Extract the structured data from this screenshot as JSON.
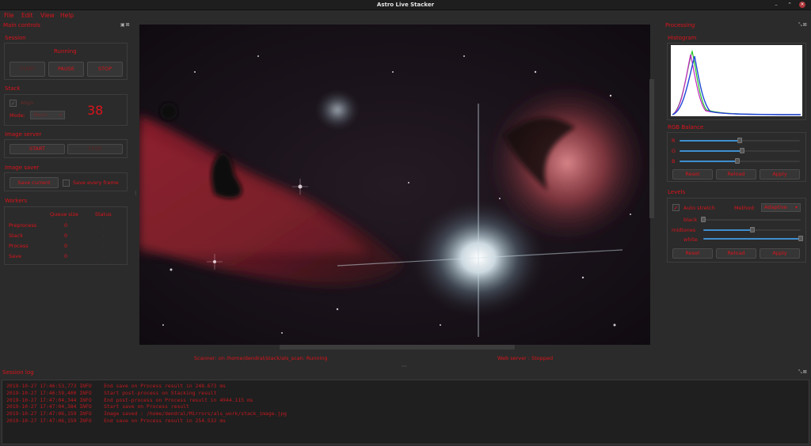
{
  "window": {
    "title": "Astro Live Stacker"
  },
  "menu": {
    "items": [
      "File",
      "Edit",
      "View",
      "Help"
    ]
  },
  "left_dock": {
    "title": "Main controls",
    "session": {
      "title": "Session",
      "status": "Running",
      "start_label": "START",
      "pause_label": "PAUSE",
      "stop_label": "STOP"
    },
    "stack": {
      "title": "Stack",
      "align_label": "Align",
      "align_checked": true,
      "mode_label": "Mode:",
      "mode_value": "Mean",
      "count": "38"
    },
    "image_server": {
      "title": "Image server",
      "start_label": "START",
      "stop_label": "STOP"
    },
    "image_saver": {
      "title": "Image saver",
      "save_current_label": "Save current",
      "save_every_label": "Save every frame",
      "save_every_checked": false
    },
    "workers": {
      "title": "Workers",
      "col_queue": "Queue size",
      "col_status": "Status",
      "rows": [
        {
          "name": "Preprocess",
          "queue": "0",
          "status": "-"
        },
        {
          "name": "Stack",
          "queue": "0",
          "status": "-"
        },
        {
          "name": "Process",
          "queue": "0",
          "status": "-"
        },
        {
          "name": "Save",
          "queue": "0",
          "status": "-"
        }
      ]
    }
  },
  "status": {
    "scanner": "Scanner: on /home/dendral/stack/als_scan: Running",
    "web_server": "Web server : Stopped"
  },
  "right_dock": {
    "title": "Processing",
    "histogram": {
      "title": "Histogram"
    },
    "rgb_balance": {
      "title": "RGB Balance",
      "r_label": "R",
      "g_label": "G",
      "b_label": "B",
      "r_value": 0.5,
      "g_value": 0.52,
      "b_value": 0.48,
      "reset_label": "Reset",
      "reload_label": "Reload",
      "apply_label": "Apply"
    },
    "levels": {
      "title": "Levels",
      "autostretch_label": "Auto stretch",
      "autostretch_checked": true,
      "method_label": "Method:",
      "method_value": "Adaptive",
      "black_label": "black",
      "midtones_label": "midtones",
      "white_label": "white",
      "black_value": 0.0,
      "midtones_value": 0.5,
      "white_value": 1.0,
      "reset_label": "Reset",
      "reload_label": "Reload",
      "apply_label": "Apply"
    }
  },
  "session_log": {
    "title": "Session log",
    "lines": [
      "2019-10-27 17:46:53,773 INFO    End save on Process result in 248.673 ms",
      "2019-10-27 17:46:59,400 INFO    Start post-process on Stacking result",
      "2019-10-27 17:47:04,344 INFO    End post-process on Process result in 4944.115 ms",
      "2019-10-27 17:47:04,384 INFO    Start save on Process result",
      "2019-10-27 17:47:06,159 INFO    Image saved : /home/dendral/Mirrors/als_work/stack_image.jpg",
      "2019-10-27 17:47:06,159 INFO    End save on Process result in 254.532 ms"
    ]
  },
  "colors": {
    "accent": "#d9141b",
    "background": "#2b2b2b",
    "slider_fill": "#3f8fcf"
  }
}
